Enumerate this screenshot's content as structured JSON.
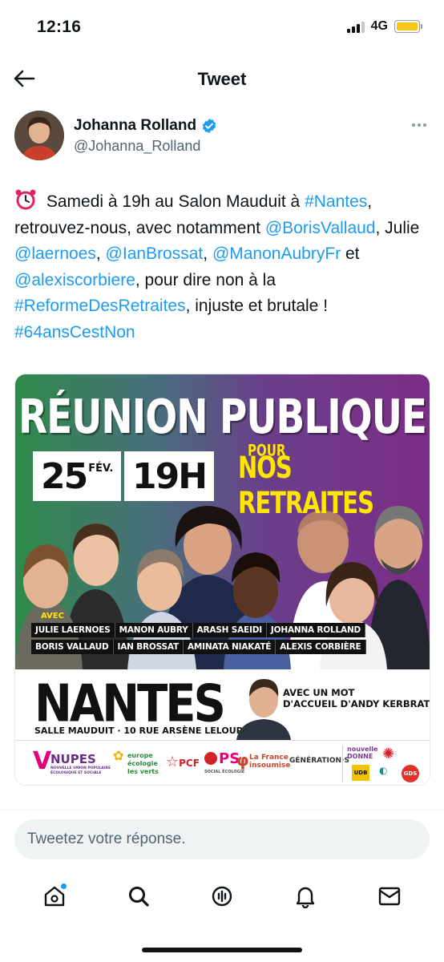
{
  "status_bar": {
    "time": "12:16",
    "network": "4G",
    "battery_color": "#f5c518"
  },
  "header": {
    "title": "Tweet",
    "back_icon": "arrow-left-icon"
  },
  "author": {
    "name": "Johanna Rolland",
    "handle": "@Johanna_Rolland",
    "verified": true
  },
  "tweet": {
    "seg1": " Samedi à 19h au Salon Mauduit à ",
    "link_nantes": "#Nantes",
    "seg2": ", retrouvez-nous, avec notamment ",
    "link_boris": "@BorisVallaud",
    "seg3": ", Julie ",
    "link_laernoes": "@laernoes",
    "seg4": ", ",
    "link_brossat": "@IanBrossat",
    "seg5": ", ",
    "link_manon": "@ManonAubryFr",
    "seg6": " et ",
    "link_alexis": "@alexiscorbiere",
    "seg7": ", pour dire non à la ",
    "link_reforme": "#ReformeDesRetraites",
    "seg8": ", injuste et brutale ! ",
    "link_64": "#64ansCestNon",
    "link_color": "#1d9bf0"
  },
  "poster": {
    "title": "RÉUNION PUBLIQUE",
    "day": "25",
    "month": "FÉV.",
    "time": "19H",
    "pour": "POUR",
    "subtitle": "NOS RETRAITES",
    "avec": "AVEC",
    "names_row1": [
      "JULIE LAERNOES",
      "MANON AUBRY",
      "ARASH SAEIDI",
      "JOHANNA ROLLAND"
    ],
    "names_row2": [
      "BORIS VALLAUD",
      "IAN BROSSAT",
      "AMINATA NIAKATÉ",
      "ALEXIS CORBIÈRE"
    ],
    "city": "NANTES",
    "venue": "SALLE MAUDUIT · 10 RUE ARSÈNE LELOUP",
    "kerbrat_line1": "AVEC UN MOT",
    "kerbrat_line2": "D'ACCUEIL D'ANDY KERBRAT",
    "logos": {
      "nupes": "NUPES",
      "nupes_sub": "NOUVELLE UNION POPULAIRE ÉCOLOGIQUE ET SOCIALE",
      "eelv": "europe écologie les verts",
      "pcf": "PCF",
      "ps": "PS",
      "ps_sub": "SOCIAL ÉCOLOGIE",
      "lfi": "La France insoumise",
      "generations": "GÉNÉRATION·S",
      "nouvelle_donne": "nouvelle DONNE",
      "udb": "UDB",
      "gds": "GDS"
    }
  },
  "reply": {
    "placeholder": "Tweetez votre réponse."
  },
  "tabs": [
    "home-icon",
    "search-icon",
    "spaces-icon",
    "bell-icon",
    "mail-icon"
  ]
}
